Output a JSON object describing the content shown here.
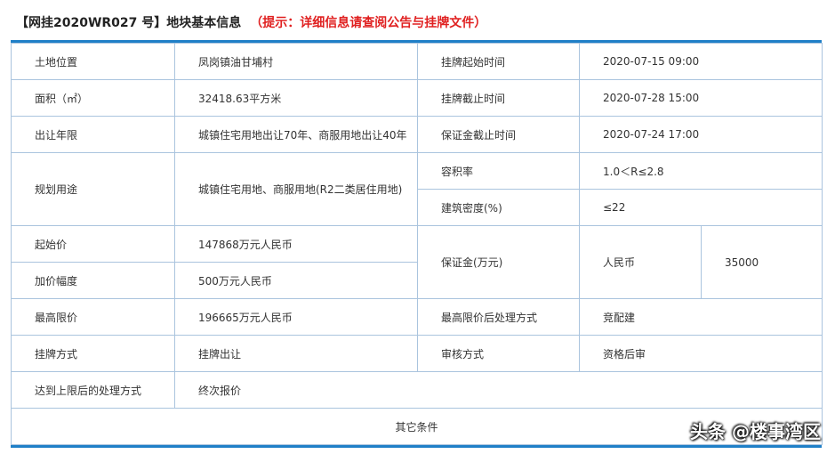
{
  "header": {
    "title": "【网挂2020WR027 号】地块基本信息",
    "tip": "（提示：详细信息请查阅公告与挂牌文件）"
  },
  "rows": {
    "r1": {
      "l1": "土地位置",
      "v1": "凤岗镇油甘埔村",
      "l2": "挂牌起始时间",
      "v2": "2020-07-15 09:00"
    },
    "r2": {
      "l1": "面积（㎡）",
      "v1": "32418.63平方米",
      "l2": "挂牌截止时间",
      "v2": "2020-07-28 15:00"
    },
    "r3": {
      "l1": "出让年限",
      "v1": "城镇住宅用地出让70年、商服用地出让40年",
      "l2": "保证金截止时间",
      "v2": "2020-07-24 17:00"
    },
    "r4": {
      "l1": "规划用途",
      "v1": "城镇住宅用地、商服用地(R2二类居住用地)",
      "l2a": "容积率",
      "v2a": "1.0＜R≤2.8",
      "l2b": "建筑密度(%)",
      "v2b": "≤22"
    },
    "r5": {
      "l1a": "起始价",
      "v1a": "147868万元人民币",
      "l1b": "加价幅度",
      "v1b": "500万元人民币",
      "l2": "保证金(万元)",
      "v2": "人民币",
      "v3": "35000"
    },
    "r6": {
      "l1": "最高限价",
      "v1": "196665万元人民币",
      "l2": "最高限价后处理方式",
      "v2": "竞配建"
    },
    "r7": {
      "l1": "挂牌方式",
      "v1": "挂牌出让",
      "l2": "审核方式",
      "v2": "资格后审"
    },
    "r8": {
      "l1": "达到上限后的处理方式",
      "v1": "终次报价"
    },
    "r9": {
      "label": "其它条件"
    }
  },
  "watermark": "头条 @楼事湾区",
  "colors": {
    "accent": "#1f7fc7",
    "border": "#aac4de",
    "tip": "#e02020"
  }
}
